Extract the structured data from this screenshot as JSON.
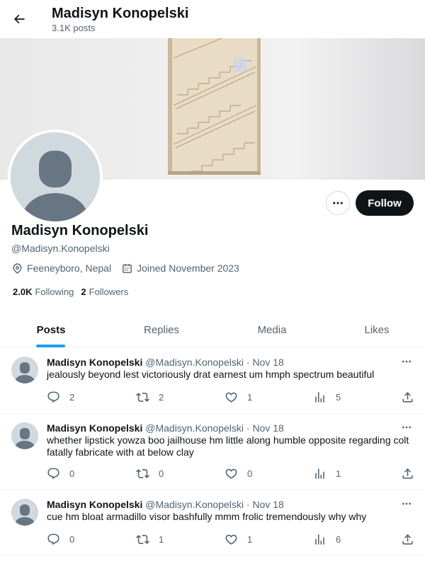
{
  "header": {
    "name": "Madisyn Konopelski",
    "post_count": "3.1K posts",
    "back_icon": "arrow-left-icon"
  },
  "profile": {
    "name": "Madisyn Konopelski",
    "handle": "@Madisyn.Konopelski",
    "location": "Feeneyboro, Nepal",
    "joined": "Joined November 2023",
    "following_count": "2.0K",
    "following_label": "Following",
    "followers_count": "2",
    "followers_label": "Followers",
    "follow_label": "Follow"
  },
  "tabs": [
    {
      "label": "Posts",
      "active": true
    },
    {
      "label": "Replies",
      "active": false
    },
    {
      "label": "Media",
      "active": false
    },
    {
      "label": "Likes",
      "active": false
    }
  ],
  "posts": [
    {
      "name": "Madisyn Konopelski",
      "handle": "@Madisyn.Konopelski",
      "dot": "·",
      "date": "Nov 18",
      "text": "jealously beyond lest victoriously drat earnest um hmph spectrum beautiful",
      "replies": "2",
      "reposts": "2",
      "likes": "1",
      "views": "5"
    },
    {
      "name": "Madisyn Konopelski",
      "handle": "@Madisyn.Konopelski",
      "dot": "·",
      "date": "Nov 18",
      "text": "whether lipstick yowza boo jailhouse hm little along humble opposite regarding colt fatally fabricate with at below clay",
      "replies": "0",
      "reposts": "0",
      "likes": "0",
      "views": "1"
    },
    {
      "name": "Madisyn Konopelski",
      "handle": "@Madisyn.Konopelski",
      "dot": "·",
      "date": "Nov 18",
      "text": "cue hm bloat armadillo visor bashfully mmm frolic tremendously why why",
      "replies": "0",
      "reposts": "1",
      "likes": "1",
      "views": "6"
    }
  ],
  "colors": {
    "accent": "#1d9bf0",
    "text_primary": "#0f1419",
    "text_secondary": "#536471",
    "follow_button": "#0f1419",
    "avatar_bg": "#cfd9de",
    "avatar_fg": "#687684"
  }
}
